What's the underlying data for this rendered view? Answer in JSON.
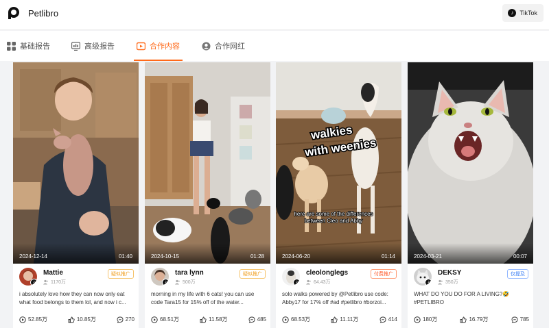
{
  "app": {
    "brand": "Petlibro",
    "platform": "TikTok"
  },
  "tabs": [
    {
      "label": "基础报告",
      "icon": "grid-icon"
    },
    {
      "label": "高级报告",
      "icon": "report-icon"
    },
    {
      "label": "合作内容",
      "icon": "content-icon",
      "active": true
    },
    {
      "label": "合作网红",
      "icon": "person-icon"
    }
  ],
  "videos": [
    {
      "date": "2024-12-14",
      "duration": "01:40",
      "author": "Mattie",
      "followers": "1170万",
      "tag": "疑似推广",
      "tag_color": "#f0a020",
      "desc1": "i absolutely love how they can now only eat",
      "desc2": "what food belongs to them lol, and now i c...",
      "plays": "52.85万",
      "likes": "10.85万",
      "comments": "270"
    },
    {
      "date": "2024-10-15",
      "duration": "01:28",
      "author": "tara lynn",
      "followers": "500万",
      "tag": "疑似推广",
      "tag_color": "#f0a020",
      "desc1": "morning in my life with 6 cats! you can use",
      "desc2": "code Tara15 for 15% off of the water...",
      "plays": "68.51万",
      "likes": "11.58万",
      "comments": "485"
    },
    {
      "date": "2024-06-20",
      "duration": "01:14",
      "author": "cleolonglegs",
      "followers": "64.43万",
      "tag": "付费推广",
      "tag_color": "#ff5a2a",
      "desc1": "solo walks powered by @Petlibro use code:",
      "desc2": "Abby17 for 17% off #ad #petlibro #borzoi...",
      "overlay1": "walkies",
      "overlay2": "with weenies",
      "caption1": "here are some of the differences",
      "caption2": "between Cleo and Abby",
      "plays": "68.53万",
      "likes": "11.11万",
      "comments": "414"
    },
    {
      "date": "2024-03-21",
      "duration": "00:07",
      "author": "DEKSY",
      "followers": "350万",
      "tag": "仅提及",
      "tag_color": "#3b7ff5",
      "desc1": "WHAT DO YOU DO FOR A LIVING?🤣",
      "desc2": "#PETLIBRO",
      "plays": "180万",
      "likes": "16.79万",
      "comments": "785"
    }
  ]
}
